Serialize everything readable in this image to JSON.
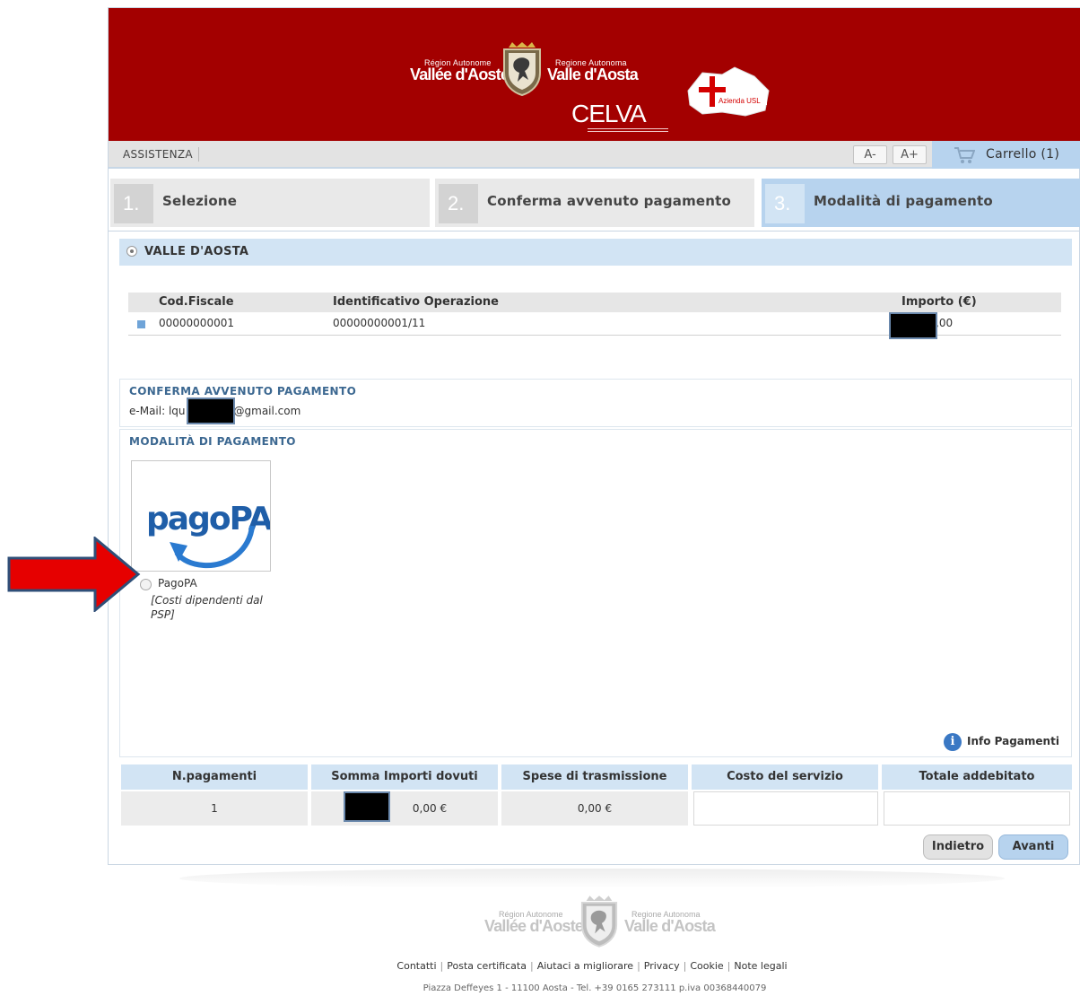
{
  "header": {
    "logo_left_small": "Région Autonome",
    "logo_left_big": "Vallée d'Aoste",
    "logo_right_small": "Regione Autonoma",
    "logo_right_big": "Valle d'Aosta",
    "celva": "CELVA",
    "usl_text": "Azienda USL"
  },
  "menubar": {
    "assistance": "ASSISTENZA",
    "font_minus": "A-",
    "font_plus": "A+",
    "cart": "Carrello (1)"
  },
  "steps": [
    {
      "num": "1.",
      "label": "Selezione"
    },
    {
      "num": "2.",
      "label": "Conferma avvenuto pagamento"
    },
    {
      "num": "3.",
      "label": "Modalità di pagamento"
    }
  ],
  "region": {
    "title": "VALLE D'AOSTA",
    "columns": [
      "Cod.Fiscale",
      "Identificativo Operazione",
      "Importo (€)"
    ],
    "row": {
      "cod_fiscale": "00000000001",
      "operazione": "00000000001/11",
      "importo": ",00"
    }
  },
  "confirm": {
    "title": "CONFERMA AVVENUTO PAGAMENTO",
    "email_prefix": "e-Mail: lqu",
    "email_suffix": "@gmail.com"
  },
  "payment": {
    "title": "MODALITÀ DI PAGAMENTO",
    "logo_text": "pagoPA",
    "option_label": "PagoPA",
    "option_note": "[Costi dipendenti dal PSP]",
    "info": "Info Pagamenti"
  },
  "summary": {
    "headers": [
      "N.pagamenti",
      "Somma Importi dovuti",
      "Spese di trasmissione",
      "Costo del servizio",
      "Totale addebitato"
    ],
    "values": [
      "1",
      "0,00 €",
      "0,00 €",
      "",
      ""
    ]
  },
  "buttons": {
    "back": "Indietro",
    "next": "Avanti"
  },
  "footer": {
    "links": [
      "Contatti",
      "Posta certificata",
      "Aiutaci a migliorare",
      "Privacy",
      "Cookie",
      "Note legali"
    ],
    "address": "Piazza Deffeyes 1 - 11100 Aosta - Tel. +39 0165 273111 p.iva 00368440079"
  },
  "colors": {
    "banner": "#a30000",
    "accent": "#b7d3ee",
    "section_title": "#3c6891",
    "arrow": "#e60000"
  }
}
